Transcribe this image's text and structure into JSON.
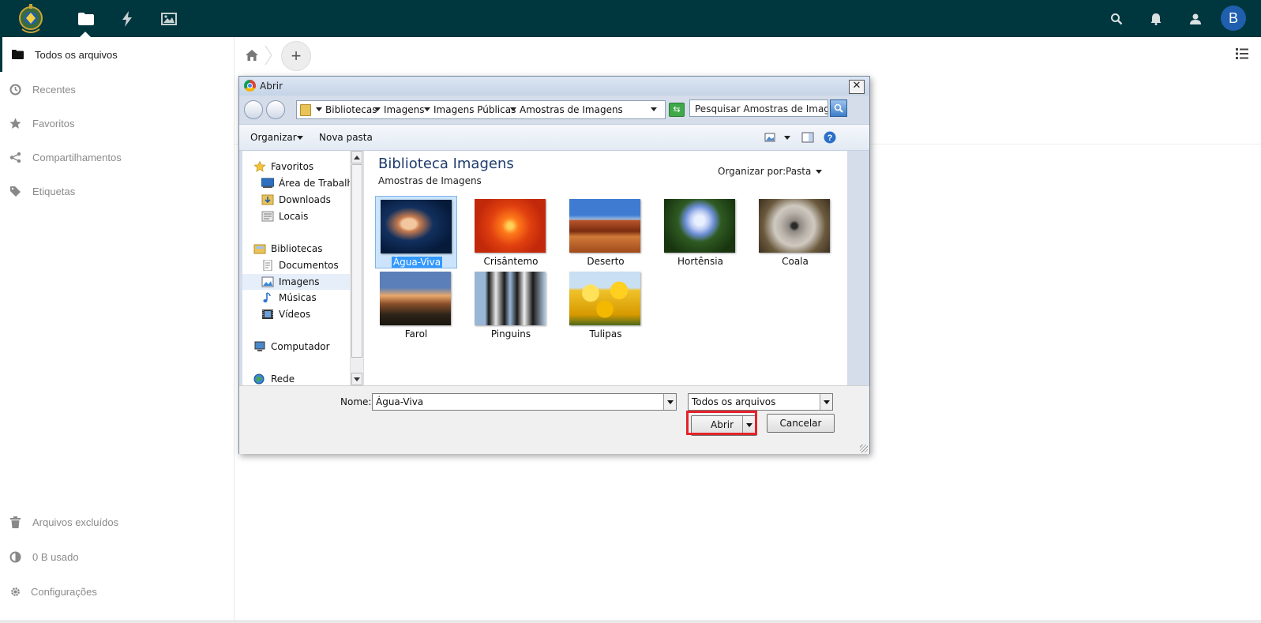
{
  "header": {
    "apps": [
      {
        "icon": "folder-icon",
        "label": "Arquivos"
      },
      {
        "icon": "activity-bolt-icon",
        "label": "Atividade"
      },
      {
        "icon": "gallery-image-icon",
        "label": "Galeria"
      }
    ],
    "avatar_initial": "B",
    "brand_color": "#00363e",
    "avatar_color": "#1f5fae"
  },
  "sidebar": {
    "items": [
      {
        "label": "Todos os arquivos",
        "icon": "folder-icon",
        "active": true
      },
      {
        "label": "Recentes",
        "icon": "clock-icon"
      },
      {
        "label": "Favoritos",
        "icon": "star-icon"
      },
      {
        "label": "Compartilhamentos",
        "icon": "share-icon"
      },
      {
        "label": "Etiquetas",
        "icon": "tag-icon"
      }
    ],
    "bottom_items": [
      {
        "label": "Arquivos excluídos",
        "icon": "trash-icon"
      },
      {
        "label": "0 B usado",
        "icon": "quota-pie-icon"
      },
      {
        "label": "Configurações",
        "icon": "gear-icon"
      }
    ]
  },
  "dialog": {
    "title": "Abrir",
    "close": "✕",
    "breadcrumb": [
      "Bibliotecas",
      "Imagens",
      "Imagens Públicas",
      "Amostras de Imagens"
    ],
    "search_placeholder": "Pesquisar Amostras de Imag...",
    "toolbar": {
      "organize": "Organizar",
      "new_folder": "Nova pasta"
    },
    "nav": {
      "favorites_header": "Favoritos",
      "favorites": [
        "Área de Trabalho",
        "Downloads",
        "Locais"
      ],
      "libraries_header": "Bibliotecas",
      "libraries": [
        "Documentos",
        "Imagens",
        "Músicas",
        "Vídeos"
      ],
      "computer": "Computador",
      "network": "Rede",
      "selected": "Imagens"
    },
    "content": {
      "title": "Biblioteca Imagens",
      "subtitle": "Amostras de Imagens",
      "sort_label": "Organizar por:",
      "sort_value": "Pasta",
      "files": [
        "Água-Viva",
        "Crisântemo",
        "Deserto",
        "Hortênsia",
        "Coala",
        "Farol",
        "Pinguins",
        "Tulipas"
      ],
      "selected": "Água-Viva"
    },
    "filename_label": "Nome:",
    "filename_value": "Água-Viva",
    "filetype_value": "Todos os arquivos",
    "open_label": "Abrir",
    "cancel_label": "Cancelar",
    "highlight_color": "#e4232b"
  }
}
